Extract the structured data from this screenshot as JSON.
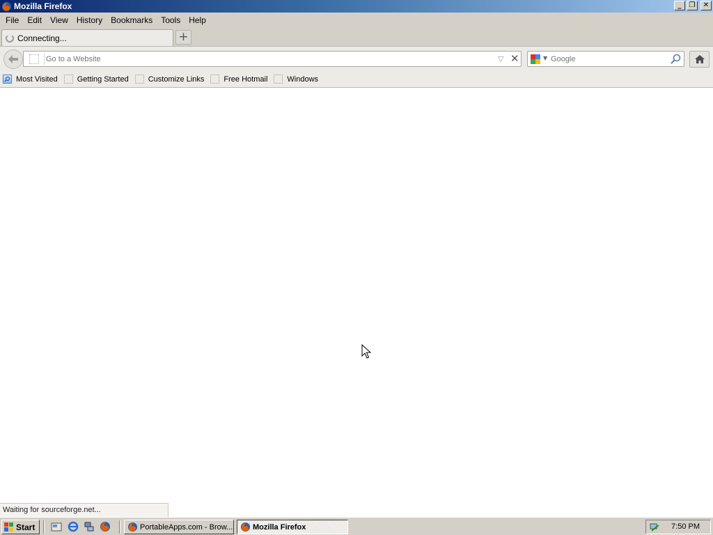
{
  "window": {
    "title": "Mozilla Firefox",
    "controls": {
      "minimize": "_",
      "maximize": "❐",
      "close": "✕"
    }
  },
  "menubar": {
    "items": [
      {
        "label": "File"
      },
      {
        "label": "Edit"
      },
      {
        "label": "View"
      },
      {
        "label": "History"
      },
      {
        "label": "Bookmarks"
      },
      {
        "label": "Tools"
      },
      {
        "label": "Help"
      }
    ]
  },
  "tabs": {
    "active_label": "Connecting...",
    "new_tab_symbol": "+"
  },
  "navbar": {
    "url_placeholder": "Go to a Website",
    "search_placeholder": "Google"
  },
  "bookmarks": {
    "items": [
      {
        "label": "Most Visited"
      },
      {
        "label": "Getting Started"
      },
      {
        "label": "Customize Links"
      },
      {
        "label": "Free Hotmail"
      },
      {
        "label": "Windows"
      }
    ]
  },
  "status": {
    "text": "Waiting for sourceforge.net..."
  },
  "taskbar": {
    "start_label": "Start",
    "tasks": [
      {
        "label": "PortableApps.com - Brow..."
      },
      {
        "label": "Mozilla Firefox"
      }
    ],
    "clock": "7:50 PM"
  },
  "colors": {
    "titlebar_start": "#0a246a",
    "titlebar_end": "#a6caf0",
    "chrome_bg": "#d4d0c8",
    "toolbar_bg": "#ecebe7"
  },
  "icons": {
    "app": "firefox-icon",
    "back": "back-arrow-icon",
    "home": "home-icon",
    "search": "magnifier-icon",
    "engine": "google-icon"
  }
}
